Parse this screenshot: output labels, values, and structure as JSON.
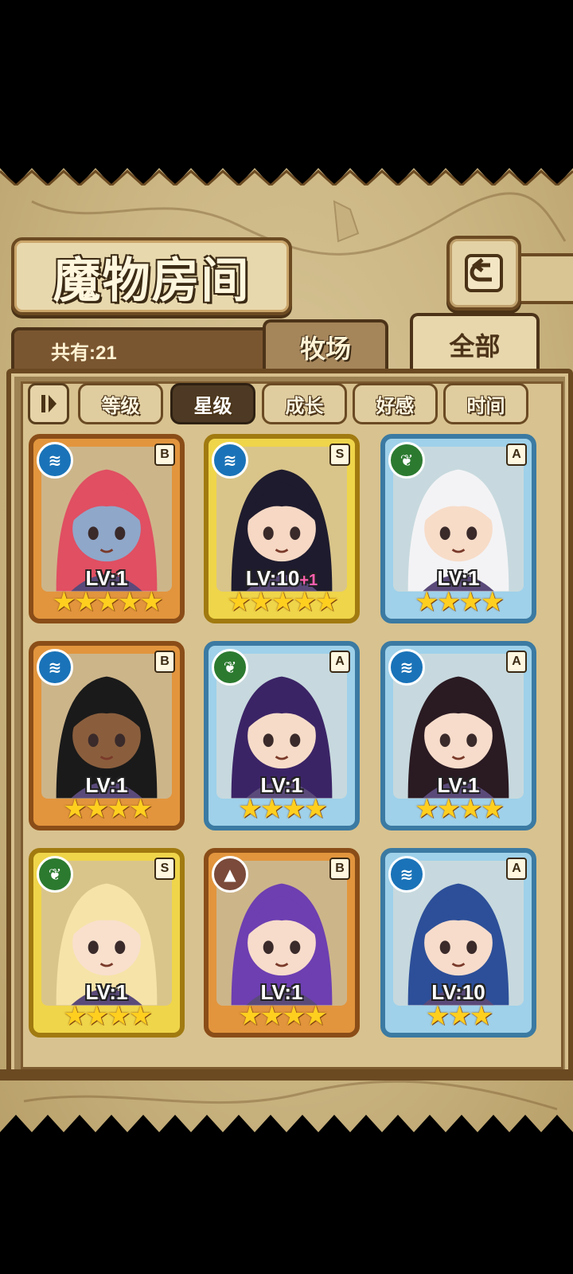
{
  "header": {
    "title": "魔物房间",
    "back_icon": "return-arrow-icon"
  },
  "count": {
    "label": "共有:21"
  },
  "tabs": [
    {
      "label": "牧场",
      "active": false
    },
    {
      "label": "全部",
      "active": true
    }
  ],
  "sort": {
    "toggle_icon": "sort-order-icon",
    "options": [
      {
        "label": "等级",
        "active": false
      },
      {
        "label": "星级",
        "active": true
      },
      {
        "label": "成长",
        "active": false
      },
      {
        "label": "好感",
        "active": false
      },
      {
        "label": "时间",
        "active": false
      }
    ]
  },
  "monsters": [
    {
      "element": "water",
      "rank": "B",
      "frame": "bronze",
      "level": "LV:1",
      "bonus": "",
      "stars": "★★★★★",
      "hair": "#e04f62",
      "skin": "#8fa7c9"
    },
    {
      "element": "water",
      "rank": "S",
      "frame": "gold",
      "level": "LV:10",
      "bonus": "+1",
      "stars": "★★★★★",
      "hair": "#1e1b2e",
      "skin": "#f6d8c4"
    },
    {
      "element": "grass",
      "rank": "A",
      "frame": "blue",
      "level": "LV:1",
      "bonus": "",
      "stars": "★★★★",
      "hair": "#f3f3f5",
      "skin": "#f7dcc8"
    },
    {
      "element": "water",
      "rank": "B",
      "frame": "bronze",
      "level": "LV:1",
      "bonus": "",
      "stars": "★★★★",
      "hair": "#1a1a1a",
      "skin": "#8a5e3d"
    },
    {
      "element": "grass",
      "rank": "A",
      "frame": "blue",
      "level": "LV:1",
      "bonus": "",
      "stars": "★★★★",
      "hair": "#3b2466",
      "skin": "#f6dcc8"
    },
    {
      "element": "water",
      "rank": "A",
      "frame": "blue",
      "level": "LV:1",
      "bonus": "",
      "stars": "★★★★",
      "hair": "#2a1a22",
      "skin": "#f7dccb"
    },
    {
      "element": "grass",
      "rank": "S",
      "frame": "gold",
      "level": "LV:1",
      "bonus": "",
      "stars": "★★★★",
      "hair": "#f6e3a8",
      "skin": "#f8e0cd"
    },
    {
      "element": "earth",
      "rank": "B",
      "frame": "bronze",
      "level": "LV:1",
      "bonus": "",
      "stars": "★★★★",
      "hair": "#6d3fb1",
      "skin": "#f7dccb"
    },
    {
      "element": "water",
      "rank": "A",
      "frame": "blue",
      "level": "LV:10",
      "bonus": "",
      "stars": "★★★",
      "hair": "#2d4f99",
      "skin": "#f7dccb"
    }
  ],
  "element_icons": {
    "water": "water-wave-icon",
    "grass": "leaf-icon",
    "earth": "mountain-icon"
  }
}
